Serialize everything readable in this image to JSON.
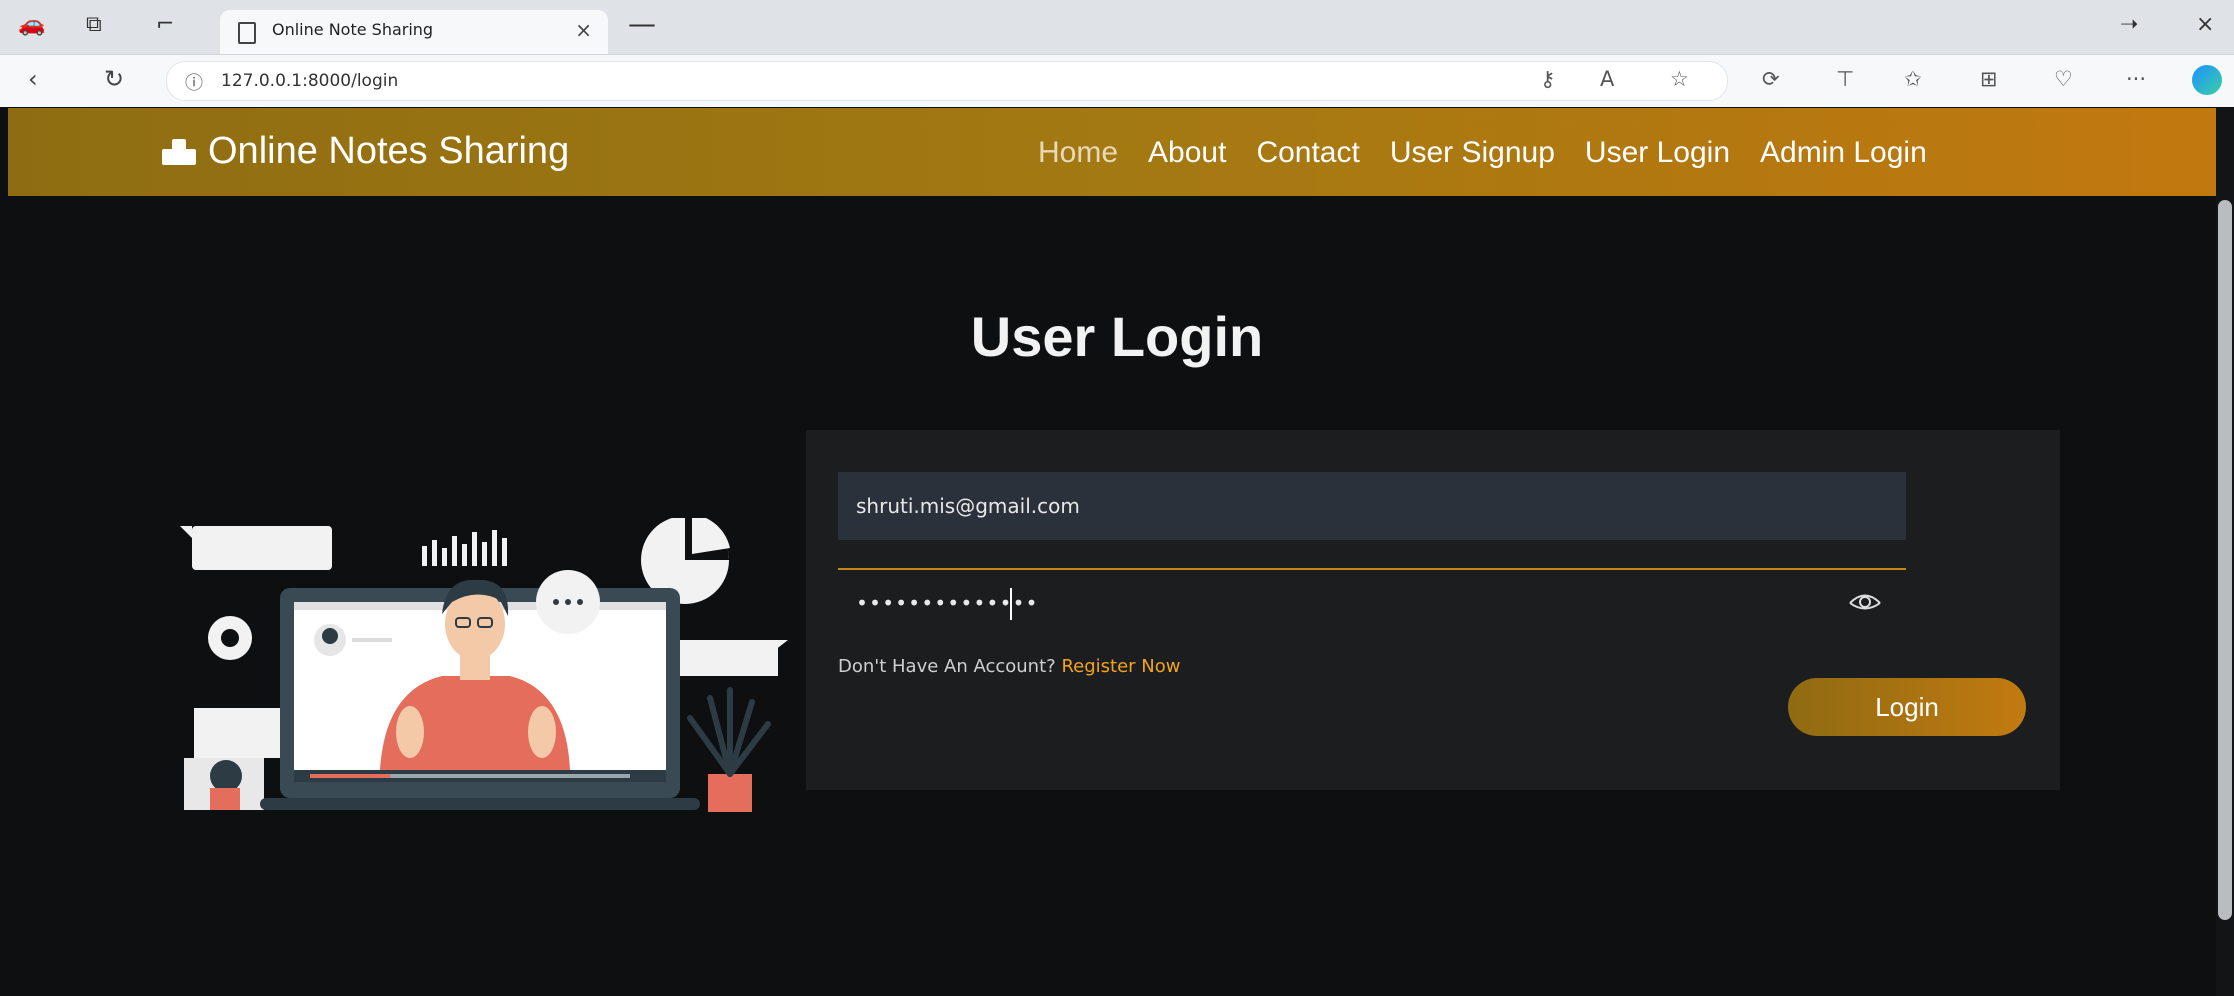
{
  "browser": {
    "tab_title": "Online Note Sharing",
    "url": "127.0.0.1:8000/login"
  },
  "site": {
    "brand": "Online Notes Sharing",
    "nav": [
      "Home",
      "About",
      "Contact",
      "User Signup",
      "User Login",
      "Admin Login"
    ]
  },
  "page": {
    "heading": "User Login"
  },
  "form": {
    "email_value": "shruti.mis@gmail.com",
    "password_value": "••••••••••••••",
    "no_account_text": "Don't Have An Account?",
    "register_link": "Register Now",
    "login_label": "Login"
  },
  "colors": {
    "accent": "#c2780f",
    "link": "#f3a41d",
    "background": "#0d0f10"
  }
}
